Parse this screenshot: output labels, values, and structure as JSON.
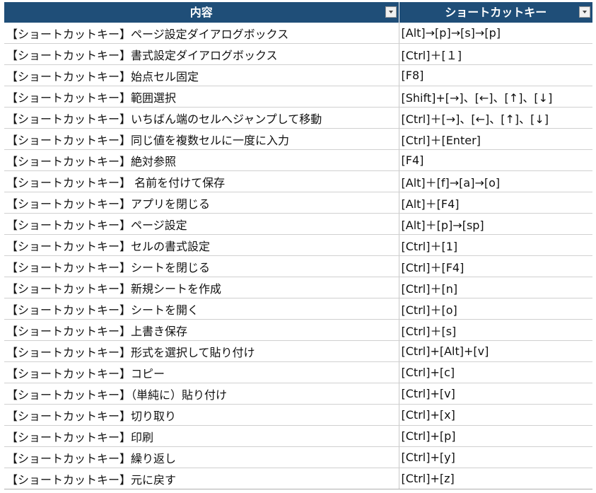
{
  "header": {
    "content_label": "内容",
    "shortcut_label": "ショートカットキー"
  },
  "rows": [
    {
      "content": "【ショートカットキー】ページ設定ダイアログボックス",
      "key": "[Alt]→[p]→[s]→[p]"
    },
    {
      "content": "【ショートカットキー】書式設定ダイアログボックス",
      "key": "[Ctrl]＋[１]"
    },
    {
      "content": "【ショートカットキー】始点セル固定",
      "key": "[F8]"
    },
    {
      "content": "【ショートカットキー】範囲選択",
      "key": "[Shift]+[→]、[←]、[↑]、[↓]"
    },
    {
      "content": "【ショートカットキー】いちばん端のセルへジャンプして移動",
      "key": "[Ctrl]＋[→]、[←]、[↑]、[↓]"
    },
    {
      "content": "【ショートカットキー】同じ値を複数セルに一度に入力",
      "key": "[Ctrl]＋[Enter]"
    },
    {
      "content": "【ショートカットキー】絶対参照",
      "key": "[F4]"
    },
    {
      "content": "【ショートカットキー】 名前を付けて保存",
      "key": "[Alt]＋[f]→[a]→[o]"
    },
    {
      "content": "【ショートカットキー】アプリを閉じる",
      "key": "[Alt]＋[F4]"
    },
    {
      "content": "【ショートカットキー】ページ設定",
      "key": "[Alt]＋[p]→[sp]"
    },
    {
      "content": "【ショートカットキー】セルの書式設定",
      "key": "[Ctrl]＋[1]"
    },
    {
      "content": "【ショートカットキー】シートを閉じる",
      "key": "[Ctrl]＋[F4]"
    },
    {
      "content": "【ショートカットキー】新規シートを作成",
      "key": "[Ctrl]＋[n]"
    },
    {
      "content": "【ショートカットキー】シートを開く",
      "key": "[Ctrl]＋[o]"
    },
    {
      "content": "【ショートカットキー】上書き保存",
      "key": "[Ctrl]＋[s]"
    },
    {
      "content": "【ショートカットキー】形式を選択して貼り付け",
      "key": "[Ctrl]+[Alt]+[v]"
    },
    {
      "content": "【ショートカットキー】コピー",
      "key": "[Ctrl]+[c]"
    },
    {
      "content": "【ショートカットキー】（単純に）貼り付け",
      "key": "[Ctrl]+[v]"
    },
    {
      "content": "【ショートカットキー】切り取り",
      "key": "[Ctrl]+[x]"
    },
    {
      "content": "【ショートカットキー】印刷",
      "key": "[Ctrl]+[p]"
    },
    {
      "content": "【ショートカットキー】繰り返し",
      "key": "[Ctrl]+[y]"
    },
    {
      "content": "【ショートカットキー】元に戻す",
      "key": "[Ctrl]+[z]"
    }
  ]
}
